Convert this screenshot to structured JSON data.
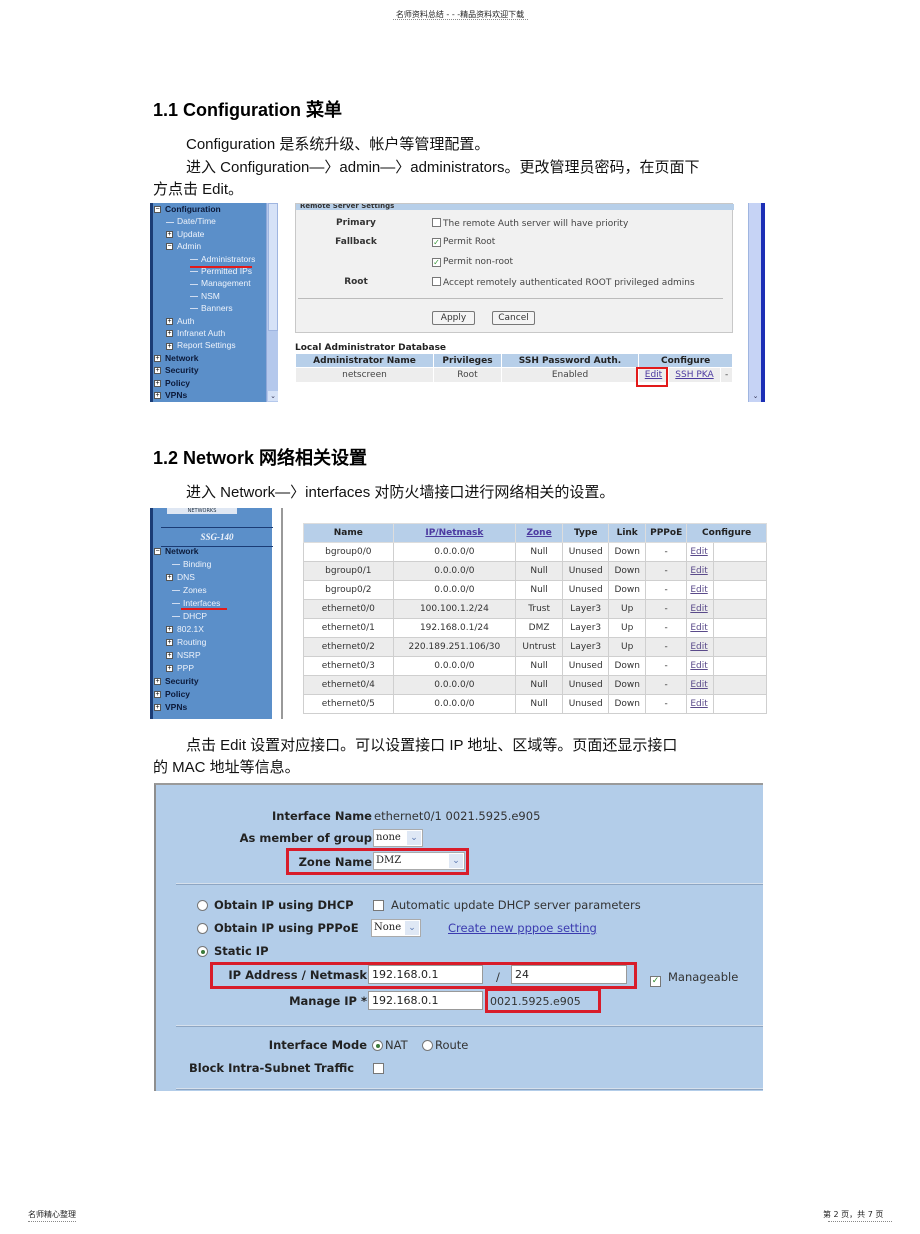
{
  "header": {
    "text": "名师资料总结 - - -精品资料欢迎下载"
  },
  "footer": {
    "left": "名师精心整理",
    "right": "第 2 页，共 7 页"
  },
  "section1": {
    "heading": "1.1 Configuration 菜单",
    "para1": "Configuration 是系统升级、帐户等管理配置。",
    "para2_line1": "进入 Configuration—〉admin—〉administrators。更改管理员密码，在页面下",
    "para2_line2": "方点击  Edit。"
  },
  "screenshot1": {
    "nav": [
      {
        "label": "Configuration",
        "expander": "−",
        "level": 0,
        "bold": true
      },
      {
        "label": "Date/Time",
        "expander": "",
        "level": 1
      },
      {
        "label": "Update",
        "expander": "+",
        "level": 1
      },
      {
        "label": "Admin",
        "expander": "−",
        "level": 1
      },
      {
        "label": "Administrators",
        "expander": "",
        "level": 2,
        "selected": true
      },
      {
        "label": "Permitted IPs",
        "expander": "",
        "level": 2
      },
      {
        "label": "Management",
        "expander": "",
        "level": 2
      },
      {
        "label": "NSM",
        "expander": "",
        "level": 2
      },
      {
        "label": "Banners",
        "expander": "",
        "level": 2
      },
      {
        "label": "Auth",
        "expander": "+",
        "level": 1
      },
      {
        "label": "Infranet Auth",
        "expander": "+",
        "level": 1
      },
      {
        "label": "Report Settings",
        "expander": "+",
        "level": 1
      },
      {
        "label": "Network",
        "expander": "+",
        "level": 0,
        "bold": true
      },
      {
        "label": "Security",
        "expander": "+",
        "level": 0,
        "bold": true
      },
      {
        "label": "Policy",
        "expander": "+",
        "level": 0,
        "bold": true
      },
      {
        "label": "VPNs",
        "expander": "+",
        "level": 0,
        "bold": true
      }
    ],
    "remote_settings": {
      "title": "Remote Server Settings",
      "rows": [
        {
          "label": "Primary",
          "option": "The remote Auth server will have priority",
          "checked": false
        },
        {
          "label": "Fallback",
          "option": "Permit Root",
          "checked": true
        },
        {
          "label": "",
          "option": "Permit non-root",
          "checked": true
        },
        {
          "label": "Root",
          "option": "Accept remotely authenticated ROOT privileged admins",
          "checked": false
        }
      ],
      "apply_label": "Apply",
      "cancel_label": "Cancel"
    },
    "admin_db": {
      "title": "Local Administrator Database",
      "columns": [
        "Administrator Name",
        "Privileges",
        "SSH Password Auth.",
        "Configure"
      ],
      "rows": [
        {
          "name": "netscreen",
          "privileges": "Root",
          "ssh_auth": "Enabled",
          "edit": "Edit",
          "ssh_pka": "SSH PKA",
          "extra": "-"
        }
      ]
    }
  },
  "section2": {
    "heading": "1.2 Network 网络相关设置",
    "para1": "进入 Network—〉interfaces 对防火墙接口进行网络相关的设置。",
    "para2_line1": "点击  Edit 设置对应接口。可以设置接口     IP 地址、区域等。页面还显示接口",
    "para2_line2": "的 MAC 地址等信息。"
  },
  "screenshot2": {
    "logo": "NETWORKS",
    "device": "SSG-140",
    "nav": [
      {
        "label": "Network",
        "expander": "−",
        "level": 0,
        "bold": true
      },
      {
        "label": "Binding",
        "expander": "",
        "level": 1
      },
      {
        "label": "DNS",
        "expander": "+",
        "level": 1
      },
      {
        "label": "Zones",
        "expander": "",
        "level": 1
      },
      {
        "label": "Interfaces",
        "expander": "",
        "level": 1,
        "selected": true
      },
      {
        "label": "DHCP",
        "expander": "",
        "level": 1
      },
      {
        "label": "802.1X",
        "expander": "+",
        "level": 1
      },
      {
        "label": "Routing",
        "expander": "+",
        "level": 1
      },
      {
        "label": "NSRP",
        "expander": "+",
        "level": 1
      },
      {
        "label": "PPP",
        "expander": "+",
        "level": 1
      },
      {
        "label": "Security",
        "expander": "+",
        "level": 0,
        "bold": true
      },
      {
        "label": "Policy",
        "expander": "+",
        "level": 0,
        "bold": true
      },
      {
        "label": "VPNs",
        "expander": "+",
        "level": 0,
        "bold": true
      }
    ],
    "table": {
      "columns": [
        "Name",
        "IP/Netmask",
        "Zone",
        "Type",
        "Link",
        "PPPoE",
        "Configure"
      ],
      "sortable": [
        false,
        true,
        true,
        false,
        false,
        false,
        false
      ],
      "rows": [
        {
          "name": "bgroup0/0",
          "ip": "0.0.0.0/0",
          "zone": "Null",
          "type": "Unused",
          "link": "Down",
          "pppoe": "-",
          "configure": "Edit"
        },
        {
          "name": "bgroup0/1",
          "ip": "0.0.0.0/0",
          "zone": "Null",
          "type": "Unused",
          "link": "Down",
          "pppoe": "-",
          "configure": "Edit"
        },
        {
          "name": "bgroup0/2",
          "ip": "0.0.0.0/0",
          "zone": "Null",
          "type": "Unused",
          "link": "Down",
          "pppoe": "-",
          "configure": "Edit"
        },
        {
          "name": "ethernet0/0",
          "ip": "100.100.1.2/24",
          "zone": "Trust",
          "type": "Layer3",
          "link": "Up",
          "pppoe": "-",
          "configure": "Edit"
        },
        {
          "name": "ethernet0/1",
          "ip": "192.168.0.1/24",
          "zone": "DMZ",
          "type": "Layer3",
          "link": "Up",
          "pppoe": "-",
          "configure": "Edit"
        },
        {
          "name": "ethernet0/2",
          "ip": "220.189.251.106/30",
          "zone": "Untrust",
          "type": "Layer3",
          "link": "Up",
          "pppoe": "-",
          "configure": "Edit"
        },
        {
          "name": "ethernet0/3",
          "ip": "0.0.0.0/0",
          "zone": "Null",
          "type": "Unused",
          "link": "Down",
          "pppoe": "-",
          "configure": "Edit"
        },
        {
          "name": "ethernet0/4",
          "ip": "0.0.0.0/0",
          "zone": "Null",
          "type": "Unused",
          "link": "Down",
          "pppoe": "-",
          "configure": "Edit"
        },
        {
          "name": "ethernet0/5",
          "ip": "0.0.0.0/0",
          "zone": "Null",
          "type": "Unused",
          "link": "Down",
          "pppoe": "-",
          "configure": "Edit"
        }
      ]
    }
  },
  "screenshot3": {
    "interface_name_label": "Interface Name",
    "interface_name_value": "ethernet0/1 0021.5925.e905",
    "member_group_label": "As member of group",
    "member_group_value": "none",
    "zone_name_label": "Zone Name",
    "zone_name_value": "DMZ",
    "dhcp_label": "Obtain IP using DHCP",
    "dhcp_auto_label": "Automatic update DHCP server parameters",
    "pppoe_label": "Obtain IP using PPPoE",
    "pppoe_value": "None",
    "pppoe_link": "Create new pppoe setting",
    "static_label": "Static IP",
    "ip_netmask_label": "IP Address / Netmask",
    "ip_value": "192.168.0.1",
    "slash": "/",
    "netmask_value": "24",
    "manageable_label": "Manageable",
    "manage_ip_label": "Manage IP *",
    "manage_ip_value": "192.168.0.1",
    "mac_value": "0021.5925.e905",
    "interface_mode_label": "Interface Mode",
    "mode_nat": "NAT",
    "mode_route": "Route",
    "block_label": "Block Intra-Subnet Traffic"
  }
}
